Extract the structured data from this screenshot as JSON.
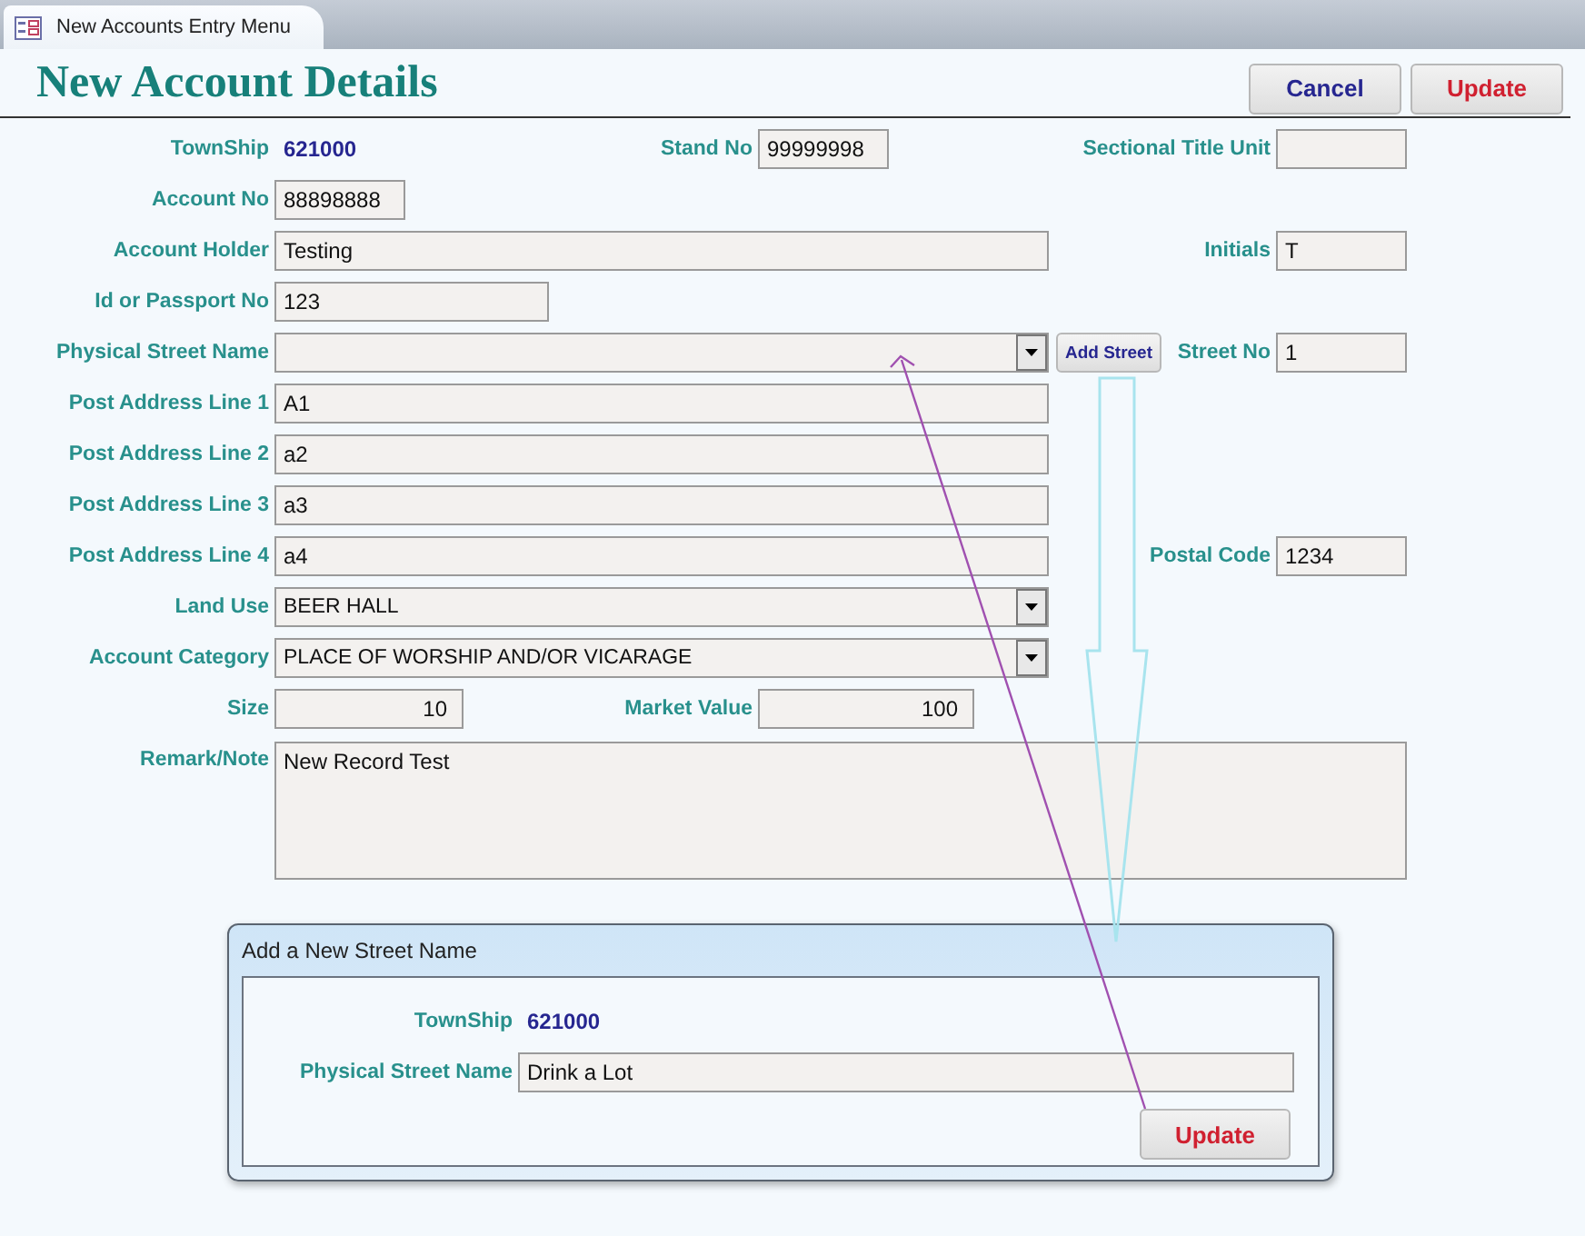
{
  "tab": {
    "title": "New Accounts Entry Menu"
  },
  "header": {
    "title": "New Account Details",
    "buttons": [
      {
        "label": "Cancel",
        "kind": "cancel"
      },
      {
        "label": "Update",
        "kind": "update"
      }
    ]
  },
  "rows": [
    {
      "items": [
        {
          "kind": "display",
          "label": "TownShip",
          "value": "621000"
        },
        {
          "kind": "text",
          "label": "Stand No",
          "value": "99999998"
        },
        {
          "kind": "text",
          "label": "Sectional Title Unit"
        }
      ]
    },
    {
      "items": [
        {
          "kind": "text",
          "label": "Account No",
          "value": "88898888"
        }
      ]
    },
    {
      "items": [
        {
          "kind": "text",
          "label": "Account Holder",
          "value": "Testing"
        },
        {
          "kind": "text",
          "label": "Initials",
          "value": "T"
        }
      ]
    },
    {
      "items": [
        {
          "kind": "text",
          "label": "Id or Passport No",
          "value": "123"
        }
      ]
    },
    {
      "items": [
        {
          "kind": "combo",
          "label": "Physical Street Name"
        },
        {
          "kind": "button",
          "value": "Add Street"
        },
        {
          "kind": "text",
          "label": "Street No",
          "value": "1"
        }
      ]
    },
    {
      "items": [
        {
          "kind": "text",
          "label": "Post Address Line 1",
          "value": "A1"
        }
      ]
    },
    {
      "items": [
        {
          "kind": "text",
          "label": "Post Address Line 2",
          "value": "a2"
        }
      ]
    },
    {
      "items": [
        {
          "kind": "text",
          "label": "Post Address Line 3",
          "value": "a3"
        }
      ]
    },
    {
      "items": [
        {
          "kind": "text",
          "label": "Post Address Line 4",
          "value": "a4"
        },
        {
          "kind": "text",
          "label": "Postal Code",
          "value": "1234"
        }
      ]
    },
    {
      "items": [
        {
          "kind": "combo",
          "label": "Land Use",
          "value": "BEER HALL"
        }
      ]
    },
    {
      "items": [
        {
          "kind": "combo",
          "label": "Account Category",
          "value": "PLACE OF WORSHIP AND/OR VICARAGE"
        }
      ]
    },
    {
      "items": [
        {
          "kind": "number",
          "label": "Size",
          "value": "10"
        },
        {
          "kind": "number",
          "label": "Market Value",
          "value": "100"
        }
      ]
    },
    {
      "items": [
        {
          "kind": "memo",
          "label": "Remark/Note",
          "value": "New Record Test"
        }
      ]
    }
  ],
  "dialog": {
    "title": "Add a New Street Name",
    "township_label": "TownShip",
    "township_value": "621000",
    "street_label": "Physical Street Name",
    "street_value": "Drink a Lot",
    "button": "Update"
  }
}
